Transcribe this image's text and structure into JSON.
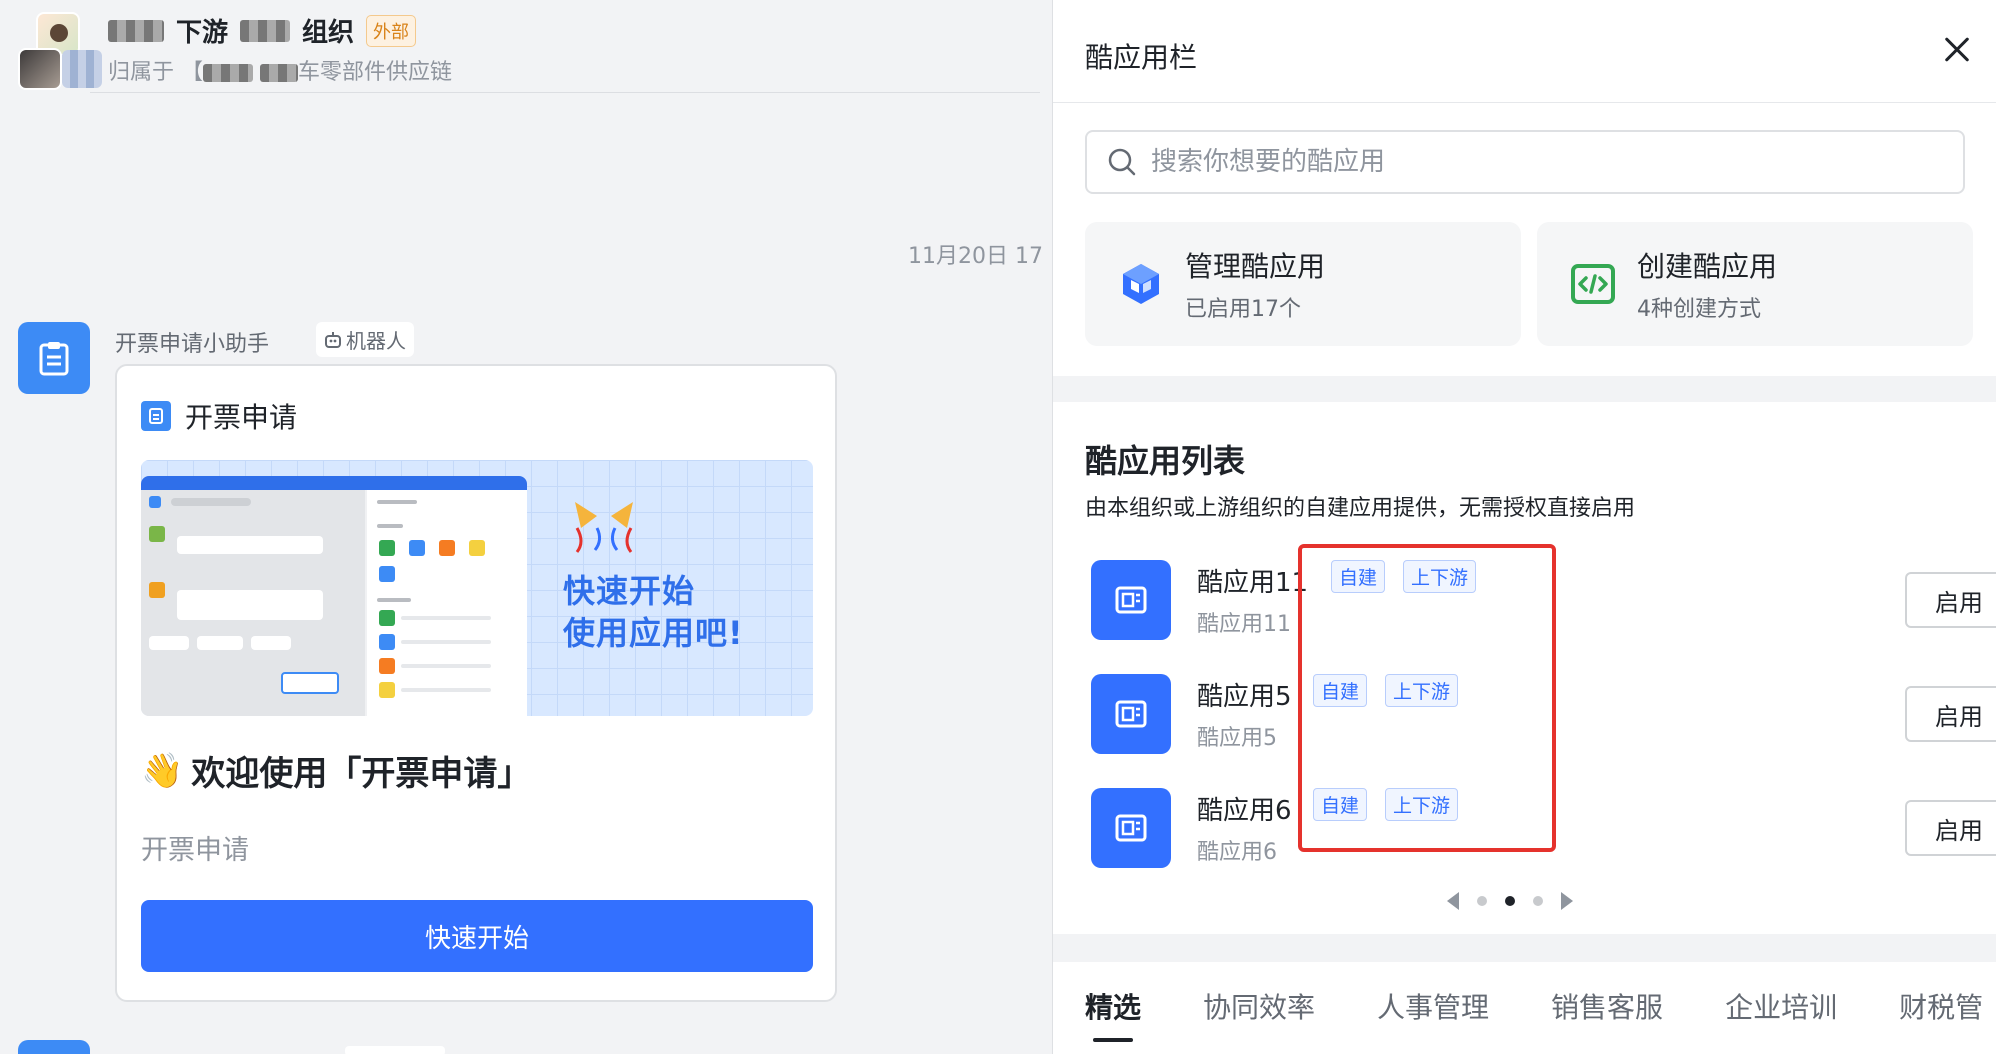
{
  "chat": {
    "title_suffix_a": "下游",
    "title_suffix_b": "组织",
    "external_tag": "外部",
    "subtitle_prefix": "归属于 【",
    "subtitle_suffix": "车零部件供应链",
    "time": "11月20日 17",
    "bot": {
      "name": "开票申请小助手",
      "tag": "机器人"
    },
    "card": {
      "title": "开票申请",
      "banner_line1": "快速开始",
      "banner_line2": "使用应用吧!",
      "welcome": "欢迎使用「开票申请」",
      "description": "开票申请",
      "button": "快速开始"
    }
  },
  "panel": {
    "title": "酷应用栏",
    "search_placeholder": "搜索你想要的酷应用",
    "manage": {
      "title": "管理酷应用",
      "subtitle": "已启用17个"
    },
    "create": {
      "title": "创建酷应用",
      "subtitle": "4种创建方式"
    },
    "list_title": "酷应用列表",
    "list_desc": "由本组织或上游组织的自建应用提供，无需授权直接启用",
    "apps": [
      {
        "name": "酷应用11",
        "subtitle": "酷应用11",
        "tags": [
          "自建",
          "上下游"
        ],
        "button": "启用"
      },
      {
        "name": "酷应用5",
        "subtitle": "酷应用5",
        "tags": [
          "自建",
          "上下游"
        ],
        "button": "启用"
      },
      {
        "name": "酷应用6",
        "subtitle": "酷应用6",
        "tags": [
          "自建",
          "上下游"
        ],
        "button": "启用"
      }
    ],
    "pager": {
      "pages": 3,
      "current": 2
    },
    "tabs": [
      "精选",
      "协同效率",
      "人事管理",
      "销售客服",
      "企业培训",
      "财税管"
    ]
  },
  "colors": {
    "accent": "#3370ff",
    "highlight": "#e5322d",
    "external_tag": "#d98319"
  }
}
